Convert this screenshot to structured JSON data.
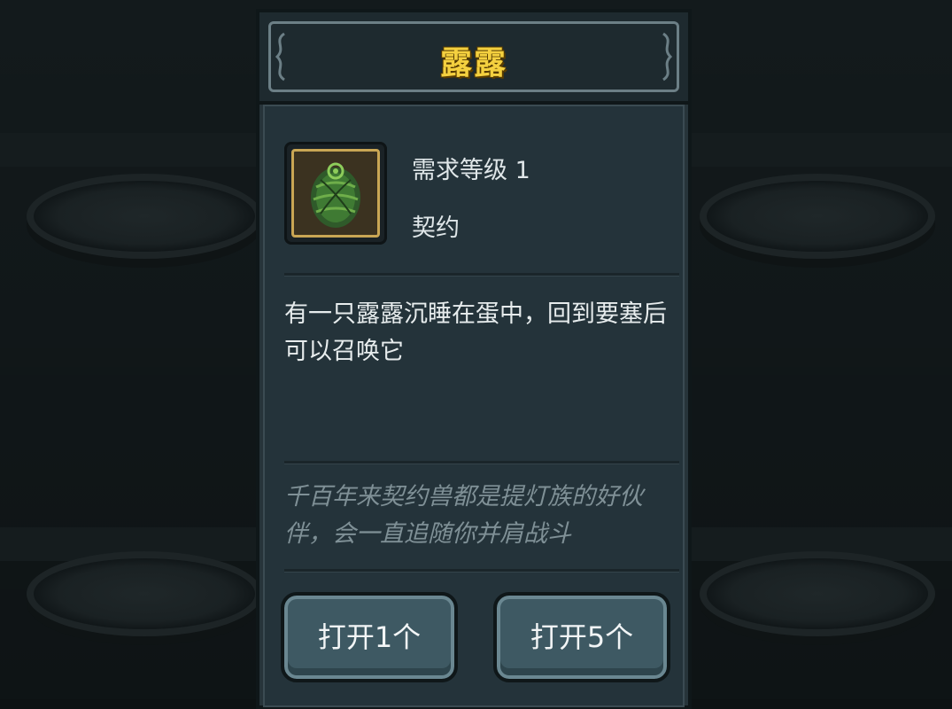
{
  "panel": {
    "title": "露露",
    "required_level": "需求等级 1",
    "item_type": "契约",
    "description": "有一只露露沉睡在蛋中，回到要塞后可以召唤它",
    "flavor_text": "千百年来契约兽都是提灯族的好伙伴，会一直追随你并肩战斗",
    "item_icon": "green-egg-icon"
  },
  "buttons": {
    "open_one": "打开1个",
    "open_five": "打开5个"
  },
  "colors": {
    "title": "#f4d03f",
    "panel_bg": "#27343a",
    "button_bg": "#3e5963",
    "item_border": "#c9a654"
  }
}
